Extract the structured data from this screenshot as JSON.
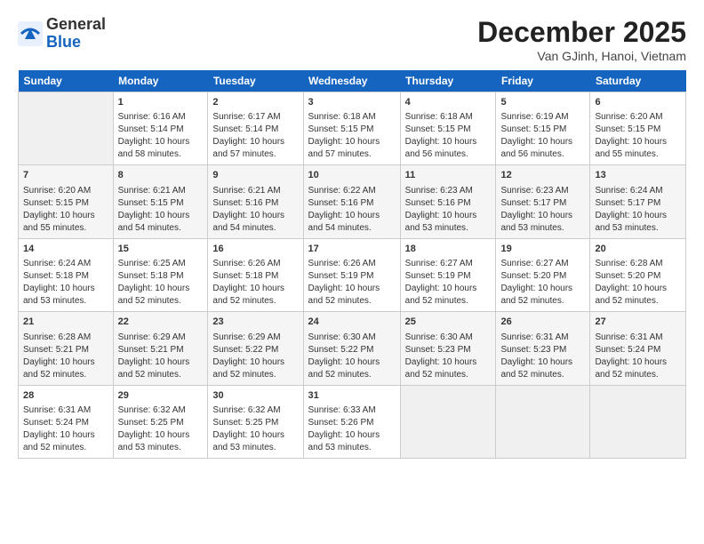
{
  "logo": {
    "general": "General",
    "blue": "Blue"
  },
  "title": "December 2025",
  "location": "Van GJinh, Hanoi, Vietnam",
  "headers": [
    "Sunday",
    "Monday",
    "Tuesday",
    "Wednesday",
    "Thursday",
    "Friday",
    "Saturday"
  ],
  "weeks": [
    [
      {
        "day": "",
        "content": ""
      },
      {
        "day": "1",
        "content": "Sunrise: 6:16 AM\nSunset: 5:14 PM\nDaylight: 10 hours\nand 58 minutes."
      },
      {
        "day": "2",
        "content": "Sunrise: 6:17 AM\nSunset: 5:14 PM\nDaylight: 10 hours\nand 57 minutes."
      },
      {
        "day": "3",
        "content": "Sunrise: 6:18 AM\nSunset: 5:15 PM\nDaylight: 10 hours\nand 57 minutes."
      },
      {
        "day": "4",
        "content": "Sunrise: 6:18 AM\nSunset: 5:15 PM\nDaylight: 10 hours\nand 56 minutes."
      },
      {
        "day": "5",
        "content": "Sunrise: 6:19 AM\nSunset: 5:15 PM\nDaylight: 10 hours\nand 56 minutes."
      },
      {
        "day": "6",
        "content": "Sunrise: 6:20 AM\nSunset: 5:15 PM\nDaylight: 10 hours\nand 55 minutes."
      }
    ],
    [
      {
        "day": "7",
        "content": "Sunrise: 6:20 AM\nSunset: 5:15 PM\nDaylight: 10 hours\nand 55 minutes."
      },
      {
        "day": "8",
        "content": "Sunrise: 6:21 AM\nSunset: 5:15 PM\nDaylight: 10 hours\nand 54 minutes."
      },
      {
        "day": "9",
        "content": "Sunrise: 6:21 AM\nSunset: 5:16 PM\nDaylight: 10 hours\nand 54 minutes."
      },
      {
        "day": "10",
        "content": "Sunrise: 6:22 AM\nSunset: 5:16 PM\nDaylight: 10 hours\nand 54 minutes."
      },
      {
        "day": "11",
        "content": "Sunrise: 6:23 AM\nSunset: 5:16 PM\nDaylight: 10 hours\nand 53 minutes."
      },
      {
        "day": "12",
        "content": "Sunrise: 6:23 AM\nSunset: 5:17 PM\nDaylight: 10 hours\nand 53 minutes."
      },
      {
        "day": "13",
        "content": "Sunrise: 6:24 AM\nSunset: 5:17 PM\nDaylight: 10 hours\nand 53 minutes."
      }
    ],
    [
      {
        "day": "14",
        "content": "Sunrise: 6:24 AM\nSunset: 5:18 PM\nDaylight: 10 hours\nand 53 minutes."
      },
      {
        "day": "15",
        "content": "Sunrise: 6:25 AM\nSunset: 5:18 PM\nDaylight: 10 hours\nand 52 minutes."
      },
      {
        "day": "16",
        "content": "Sunrise: 6:26 AM\nSunset: 5:18 PM\nDaylight: 10 hours\nand 52 minutes."
      },
      {
        "day": "17",
        "content": "Sunrise: 6:26 AM\nSunset: 5:19 PM\nDaylight: 10 hours\nand 52 minutes."
      },
      {
        "day": "18",
        "content": "Sunrise: 6:27 AM\nSunset: 5:19 PM\nDaylight: 10 hours\nand 52 minutes."
      },
      {
        "day": "19",
        "content": "Sunrise: 6:27 AM\nSunset: 5:20 PM\nDaylight: 10 hours\nand 52 minutes."
      },
      {
        "day": "20",
        "content": "Sunrise: 6:28 AM\nSunset: 5:20 PM\nDaylight: 10 hours\nand 52 minutes."
      }
    ],
    [
      {
        "day": "21",
        "content": "Sunrise: 6:28 AM\nSunset: 5:21 PM\nDaylight: 10 hours\nand 52 minutes."
      },
      {
        "day": "22",
        "content": "Sunrise: 6:29 AM\nSunset: 5:21 PM\nDaylight: 10 hours\nand 52 minutes."
      },
      {
        "day": "23",
        "content": "Sunrise: 6:29 AM\nSunset: 5:22 PM\nDaylight: 10 hours\nand 52 minutes."
      },
      {
        "day": "24",
        "content": "Sunrise: 6:30 AM\nSunset: 5:22 PM\nDaylight: 10 hours\nand 52 minutes."
      },
      {
        "day": "25",
        "content": "Sunrise: 6:30 AM\nSunset: 5:23 PM\nDaylight: 10 hours\nand 52 minutes."
      },
      {
        "day": "26",
        "content": "Sunrise: 6:31 AM\nSunset: 5:23 PM\nDaylight: 10 hours\nand 52 minutes."
      },
      {
        "day": "27",
        "content": "Sunrise: 6:31 AM\nSunset: 5:24 PM\nDaylight: 10 hours\nand 52 minutes."
      }
    ],
    [
      {
        "day": "28",
        "content": "Sunrise: 6:31 AM\nSunset: 5:24 PM\nDaylight: 10 hours\nand 52 minutes."
      },
      {
        "day": "29",
        "content": "Sunrise: 6:32 AM\nSunset: 5:25 PM\nDaylight: 10 hours\nand 53 minutes."
      },
      {
        "day": "30",
        "content": "Sunrise: 6:32 AM\nSunset: 5:25 PM\nDaylight: 10 hours\nand 53 minutes."
      },
      {
        "day": "31",
        "content": "Sunrise: 6:33 AM\nSunset: 5:26 PM\nDaylight: 10 hours\nand 53 minutes."
      },
      {
        "day": "",
        "content": ""
      },
      {
        "day": "",
        "content": ""
      },
      {
        "day": "",
        "content": ""
      }
    ]
  ]
}
